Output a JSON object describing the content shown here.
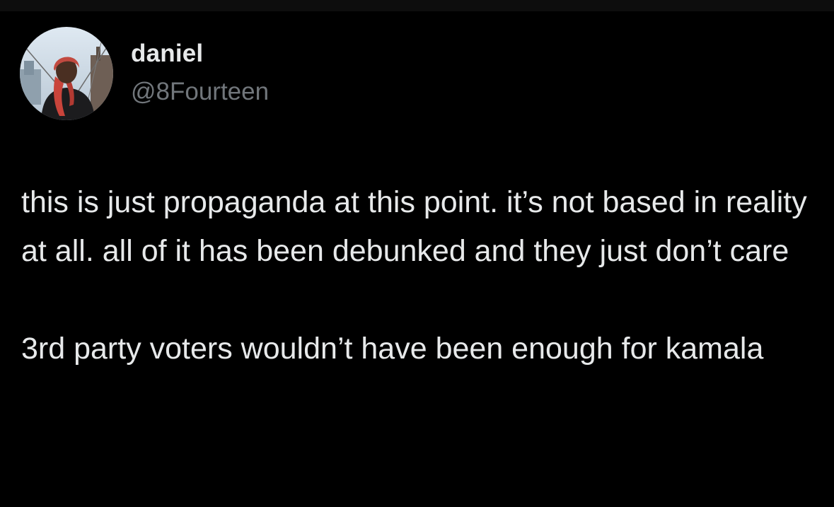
{
  "author": {
    "display_name": "daniel",
    "handle": "@8Fourteen",
    "avatar_icon": "profile-photo"
  },
  "tweet": {
    "paragraphs": [
      "this is just propaganda at this point. it’s not based in reality at all. all of it has been debunked and they just don’t care",
      "3rd party voters wouldn’t have been enough for kamala"
    ]
  },
  "colors": {
    "background": "#000000",
    "primary_text": "#e7e9ea",
    "secondary_text": "#71767b"
  }
}
